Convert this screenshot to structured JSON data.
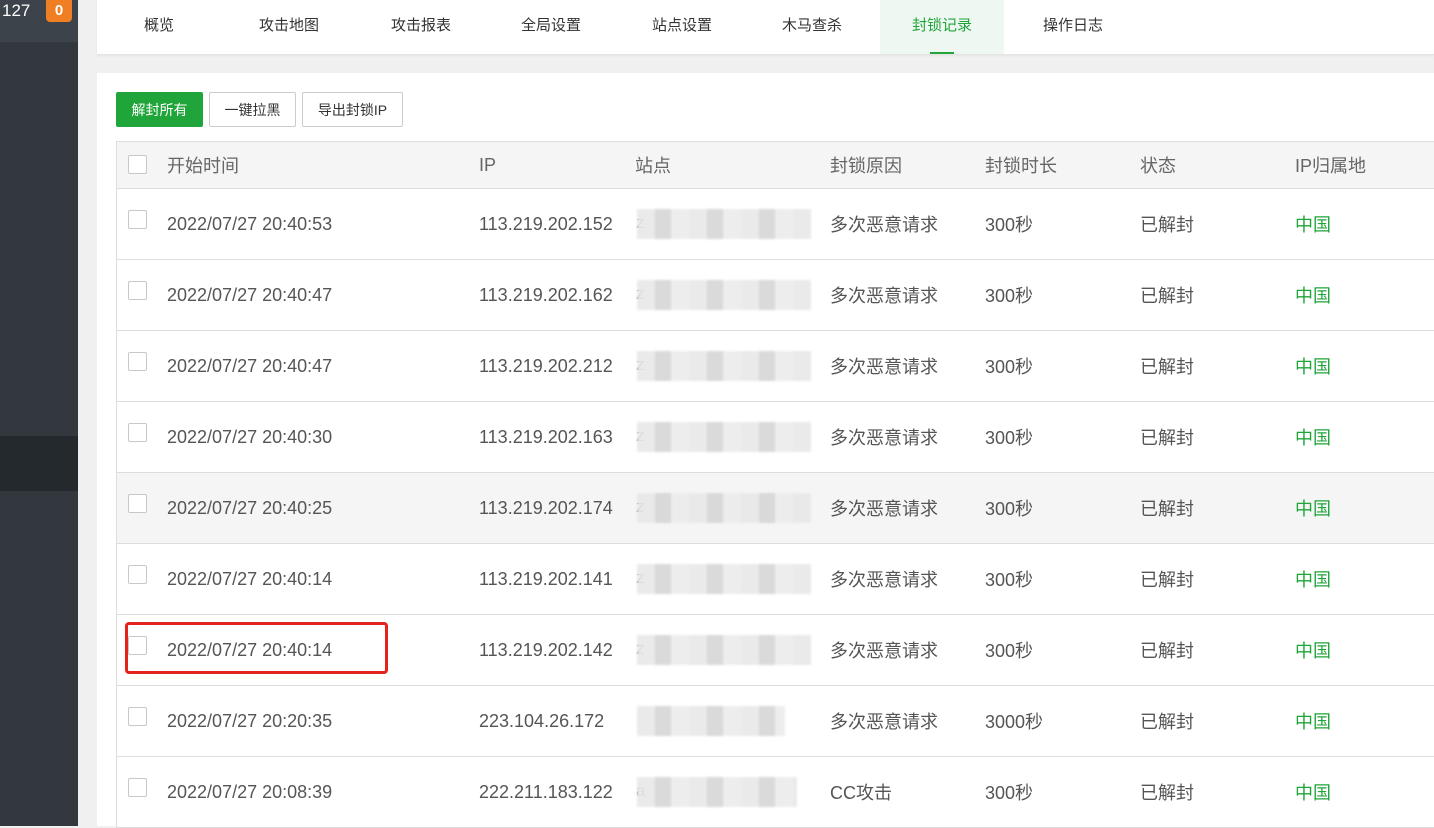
{
  "sidebar": {
    "count": "127",
    "badge": "0"
  },
  "tabs": [
    {
      "label": "概览",
      "active": false
    },
    {
      "label": "攻击地图",
      "active": false
    },
    {
      "label": "攻击报表",
      "active": false
    },
    {
      "label": "全局设置",
      "active": false
    },
    {
      "label": "站点设置",
      "active": false
    },
    {
      "label": "木马查杀",
      "active": false
    },
    {
      "label": "封锁记录",
      "active": true
    },
    {
      "label": "操作日志",
      "active": false
    }
  ],
  "toolbar": {
    "unblock_all": "解封所有",
    "blacklist": "一键拉黑",
    "export": "导出封锁IP"
  },
  "table": {
    "headers": {
      "start_time": "开始时间",
      "ip": "IP",
      "site": "站点",
      "reason": "封锁原因",
      "duration": "封锁时长",
      "status": "状态",
      "location": "IP归属地"
    },
    "rows": [
      {
        "time": "2022/07/27 20:40:53",
        "ip": "113.219.202.152",
        "site_hint": "z",
        "reason": "多次恶意请求",
        "duration": "300秒",
        "status": "已解封",
        "location": "中国"
      },
      {
        "time": "2022/07/27 20:40:47",
        "ip": "113.219.202.162",
        "site_hint": "z",
        "reason": "多次恶意请求",
        "duration": "300秒",
        "status": "已解封",
        "location": "中国"
      },
      {
        "time": "2022/07/27 20:40:47",
        "ip": "113.219.202.212",
        "site_hint": "z",
        "reason": "多次恶意请求",
        "duration": "300秒",
        "status": "已解封",
        "location": "中国"
      },
      {
        "time": "2022/07/27 20:40:30",
        "ip": "113.219.202.163",
        "site_hint": "z",
        "reason": "多次恶意请求",
        "duration": "300秒",
        "status": "已解封",
        "location": "中国"
      },
      {
        "time": "2022/07/27 20:40:25",
        "ip": "113.219.202.174",
        "site_hint": "z",
        "reason": "多次恶意请求",
        "duration": "300秒",
        "status": "已解封",
        "location": "中国"
      },
      {
        "time": "2022/07/27 20:40:14",
        "ip": "113.219.202.141",
        "site_hint": "z",
        "reason": "多次恶意请求",
        "duration": "300秒",
        "status": "已解封",
        "location": "中国"
      },
      {
        "time": "2022/07/27 20:40:14",
        "ip": "113.219.202.142",
        "site_hint": "z",
        "reason": "多次恶意请求",
        "duration": "300秒",
        "status": "已解封",
        "location": "中国"
      },
      {
        "time": "2022/07/27 20:20:35",
        "ip": "223.104.26.172",
        "site_hint": "",
        "reason": "多次恶意请求",
        "duration": "3000秒",
        "status": "已解封",
        "location": "中国"
      },
      {
        "time": "2022/07/27 20:08:39",
        "ip": "222.211.183.122",
        "site_hint": "a",
        "reason": "CC攻击",
        "duration": "300秒",
        "status": "已解封",
        "location": "中国"
      }
    ]
  },
  "colors": {
    "accent": "#20a53a",
    "highlight": "#e3231d"
  }
}
